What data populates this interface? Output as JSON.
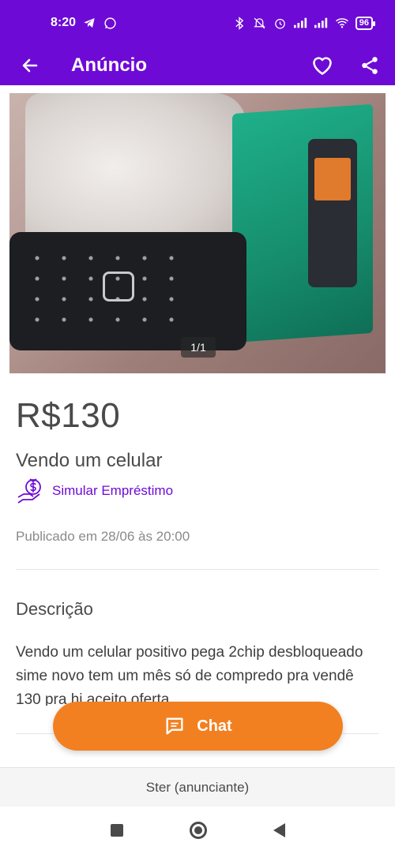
{
  "status_bar": {
    "time": "8:20",
    "battery": "96"
  },
  "app_bar": {
    "title": "Anúncio",
    "back_icon": "arrow-left-icon",
    "favorite_icon": "heart-icon",
    "share_icon": "share-icon"
  },
  "photo": {
    "pager": "1/1"
  },
  "ad": {
    "price": "R$130",
    "title": "Vendo um celular",
    "loan_label": "Simular Empréstimo",
    "published": "Publicado em 28/06 às 20:00"
  },
  "description": {
    "heading": "Descrição",
    "text": "Vendo um celular positivo pega 2chip desbloqueado sime novo tem um mês só de compredo pra vendê 130 pra hj aceito oferta"
  },
  "chat": {
    "label": "Chat"
  },
  "seller": {
    "label": "Ster (anunciante)"
  },
  "colors": {
    "primary": "#6e0ad6",
    "accent": "#f28021"
  }
}
